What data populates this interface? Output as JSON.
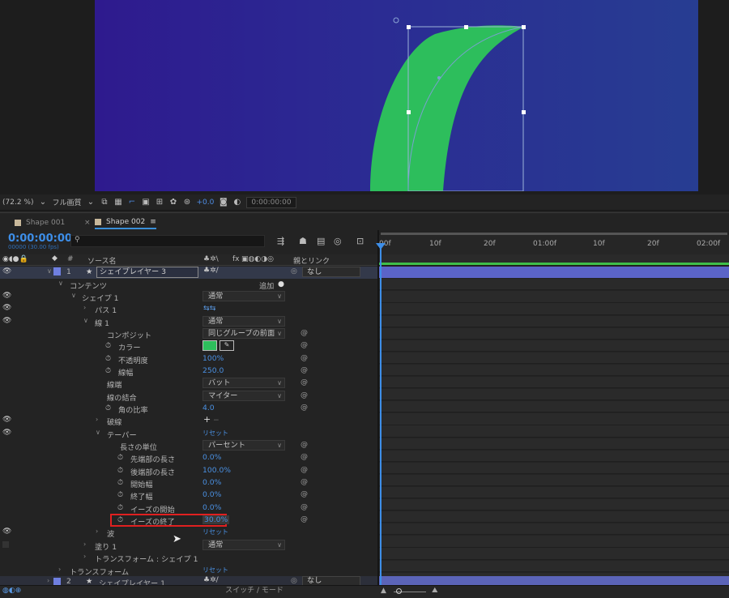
{
  "viewer": {
    "zoom": "(72.2 %)",
    "resolution": "フル画質",
    "exposure": "+0.0",
    "timecode": "0:00:00:00",
    "colors": {
      "bg_left": "#2e1a8e",
      "bg_right": "#273d92",
      "shape": "#2dbe5c",
      "handles": "#ffffff"
    }
  },
  "tabs": [
    {
      "label": "Shape 001",
      "active": false
    },
    {
      "label": "Shape 002",
      "active": true
    }
  ],
  "timeline": {
    "timecode": "0:00:00:00",
    "fps": "00000 (30.00 fps)",
    "columns": {
      "num": "#",
      "source": "ソース名",
      "parent": "親とリンク",
      "fx": "fx"
    },
    "ruler_ticks": [
      "00f",
      "10f",
      "20f",
      "01:00f",
      "10f",
      "20f",
      "02:00f"
    ],
    "switch_mode": "スイッチ / モード"
  },
  "layer1": {
    "num": "1",
    "name": "シェイプレイヤー 3",
    "parent": "なし"
  },
  "contents": {
    "label": "コンテンツ",
    "add": "追加"
  },
  "shape1": {
    "label": "シェイプ 1",
    "mode": "通常"
  },
  "path1": {
    "label": "パス 1"
  },
  "stroke1": {
    "label": "線 1",
    "mode": "通常"
  },
  "composite": {
    "label": "コンポジット",
    "value": "同じグループの前面"
  },
  "color": {
    "label": "カラー",
    "swatch": "#2dbe5c"
  },
  "opacity": {
    "label": "不透明度",
    "value": "100%"
  },
  "width": {
    "label": "線幅",
    "value": "250.0"
  },
  "linecap": {
    "label": "線端",
    "value": "バット"
  },
  "linejoin": {
    "label": "線の結合",
    "value": "マイター"
  },
  "miter": {
    "label": "角の比率",
    "value": "4.0"
  },
  "dashes": {
    "label": "破線",
    "add": "+",
    "remove": "−"
  },
  "taper": {
    "label": "テーパー",
    "reset": "リセット"
  },
  "lengthunit": {
    "label": "長さの単位",
    "value": "パーセント"
  },
  "startlength": {
    "label": "先端部の長さ",
    "value": "0.0%"
  },
  "endlength": {
    "label": "後端部の長さ",
    "value": "100.0%"
  },
  "startwidth": {
    "label": "開始幅",
    "value": "0.0%"
  },
  "endwidth": {
    "label": "終了幅",
    "value": "0.0%"
  },
  "startease": {
    "label": "イーズの開始",
    "value": "0.0%"
  },
  "endease": {
    "label": "イーズの終了",
    "value": "30.0%",
    "highlight": "#e02020"
  },
  "wave": {
    "label": "波",
    "reset": "リセット"
  },
  "fill1": {
    "label": "塗り 1",
    "mode": "通常"
  },
  "shapetransform": {
    "label": "トランスフォーム : シェイプ 1"
  },
  "transform": {
    "label": "トランスフォーム",
    "reset": "リセット"
  },
  "layer2": {
    "num": "2",
    "name": "シェイプレイヤー 1",
    "parent": "なし"
  }
}
